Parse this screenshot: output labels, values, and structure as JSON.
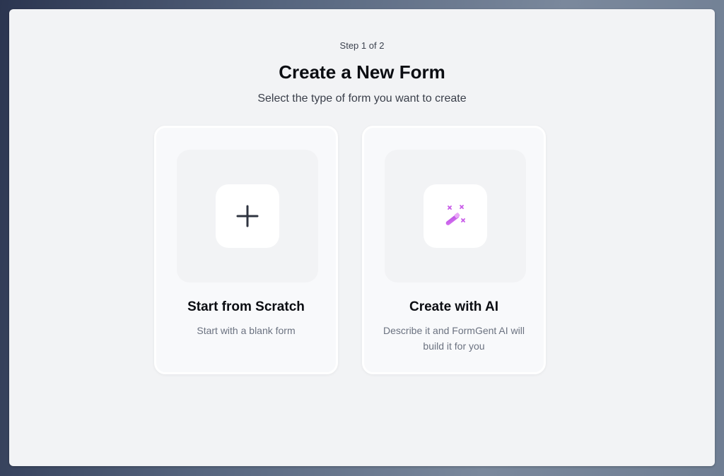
{
  "header": {
    "step": "Step 1 of 2",
    "title": "Create a New Form",
    "subtitle": "Select the type of form you want to create"
  },
  "options": [
    {
      "title": "Start from Scratch",
      "description": "Start with a blank form",
      "icon": "plus-icon"
    },
    {
      "title": "Create with AI",
      "description": "Describe it and FormGent AI will build it for you",
      "icon": "magic-wand-icon"
    }
  ],
  "colors": {
    "ai_icon_accent": "#c85ae8",
    "plus_icon": "#2f3440"
  }
}
